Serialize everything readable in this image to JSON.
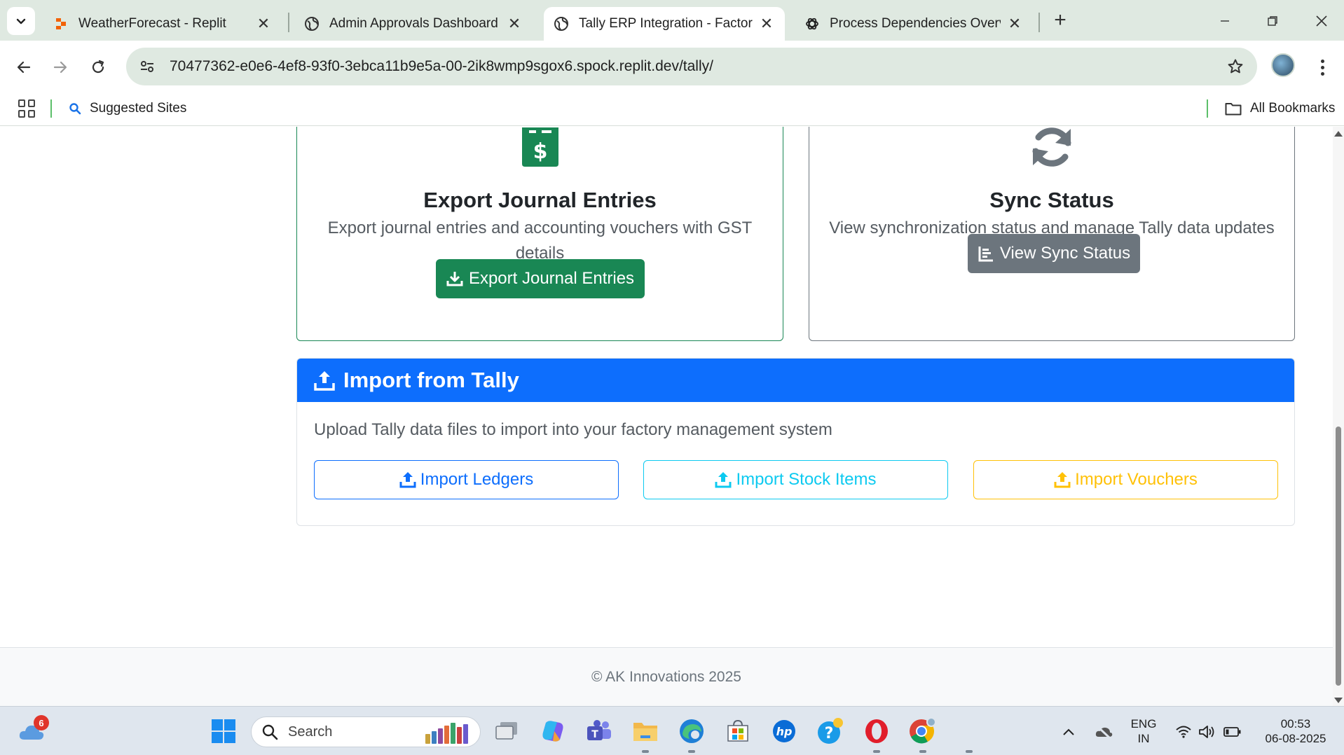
{
  "browser": {
    "tabs": [
      {
        "title": "WeatherForecast - Replit",
        "favicon": "replit-icon",
        "active": false
      },
      {
        "title": "Admin Approvals Dashboard",
        "favicon": "globe-icon",
        "active": false
      },
      {
        "title": "Tally ERP Integration - Factory M",
        "favicon": "globe-icon",
        "active": true
      },
      {
        "title": "Process Dependencies Overview",
        "favicon": "openai-icon",
        "active": false
      }
    ],
    "url": "70477362-e0e6-4ef8-93f0-3ebca11b9e5a-00-2ik8wmp9sgox6.spock.replit.dev/tally/",
    "bookmarks": {
      "suggested": "Suggested Sites",
      "all": "All Bookmarks"
    }
  },
  "page": {
    "export_card": {
      "title": "Export Journal Entries",
      "description": "Export journal entries and accounting vouchers with GST details",
      "button": "Export Journal Entries",
      "icon": "file-invoice-dollar-icon"
    },
    "sync_card": {
      "title": "Sync Status",
      "description": "View synchronization status and manage Tally data updates",
      "button": "View Sync Status",
      "icon": "sync-icon"
    },
    "import_card": {
      "title": "Import from Tally",
      "description": "Upload Tally data files to import into your factory management system",
      "buttons": [
        {
          "label": "Import Ledgers",
          "style": "primary"
        },
        {
          "label": "Import Stock Items",
          "style": "info"
        },
        {
          "label": "Import Vouchers",
          "style": "warning"
        }
      ]
    },
    "footer": "© AK Innovations 2025"
  },
  "taskbar": {
    "weather_badge": "6",
    "search_placeholder": "Search",
    "language": "ENG",
    "region": "IN",
    "time": "00:53",
    "date": "06-08-2025"
  },
  "colors": {
    "primary": "#0d6efd",
    "success": "#198754",
    "secondary": "#6c757d",
    "info": "#0dcaf0",
    "warning": "#ffc107"
  }
}
